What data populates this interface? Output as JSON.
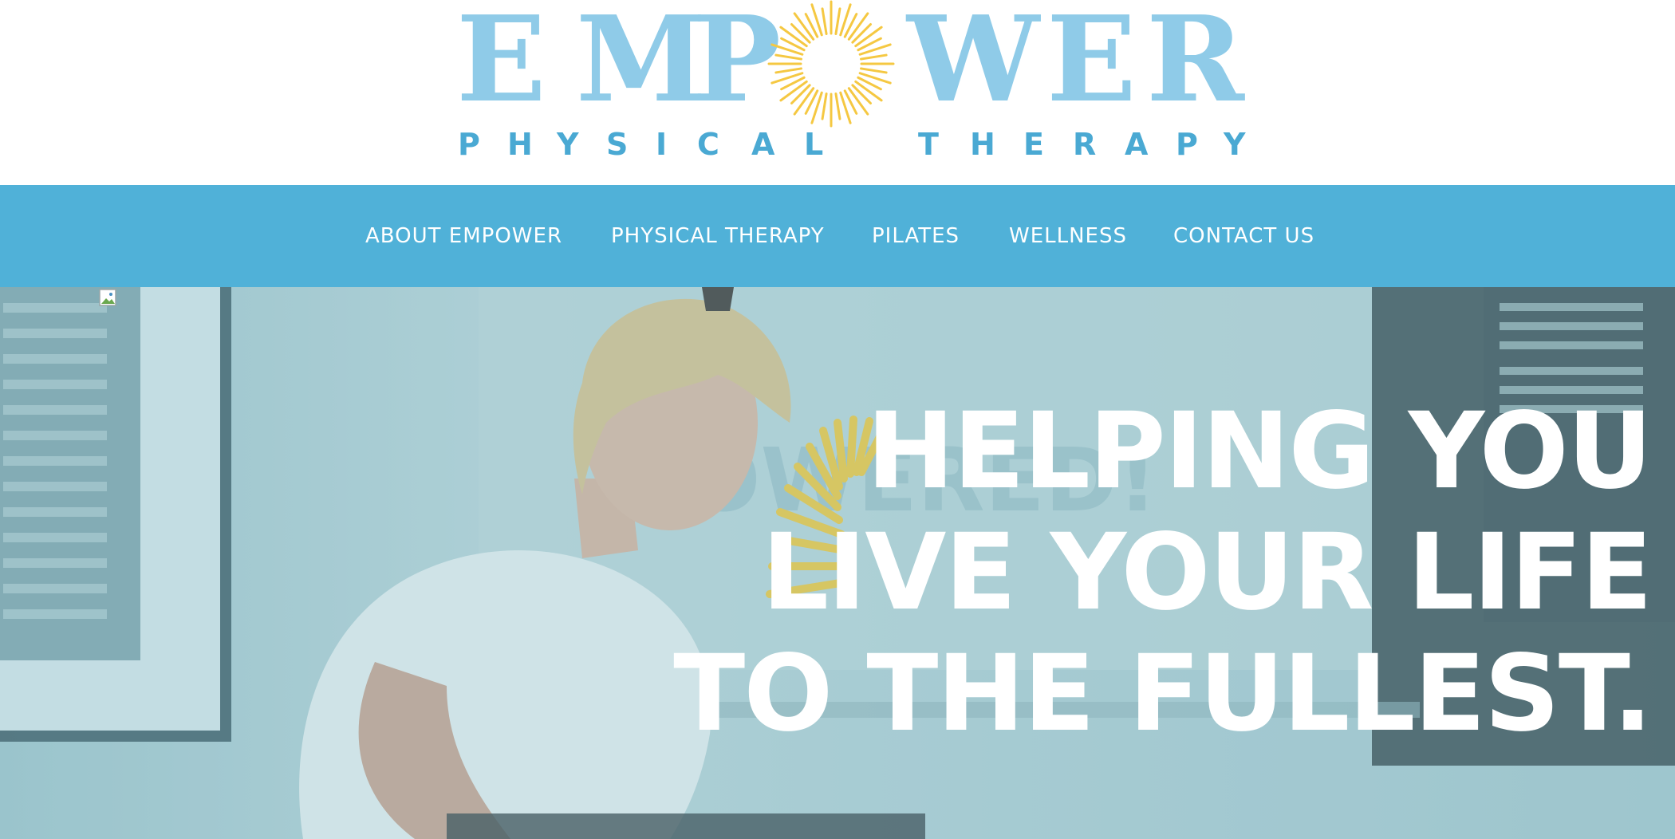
{
  "logo": {
    "main_letters": [
      "E",
      "M",
      "P",
      "W",
      "E",
      "R"
    ],
    "sub_letters": [
      "P",
      "H",
      "Y",
      "S",
      "I",
      "C",
      "A",
      "L",
      "T",
      "H",
      "E",
      "R",
      "A",
      "P",
      "Y"
    ],
    "brand_blue": "#8fcbe8",
    "sub_blue": "#4aa9d3",
    "sun_yellow": "#f5c842"
  },
  "nav": {
    "background": "#50b1d8",
    "items": [
      {
        "label": "ABOUT EMPOWER"
      },
      {
        "label": "PHYSICAL THERAPY"
      },
      {
        "label": "PILATES"
      },
      {
        "label": "WELLNESS"
      },
      {
        "label": "CONTACT US"
      }
    ]
  },
  "hero": {
    "headline": [
      "HELPING YOU",
      "LIVE YOUR LIFE",
      "TO THE FULLEST."
    ],
    "broken_image_icon": "broken-image-icon"
  }
}
